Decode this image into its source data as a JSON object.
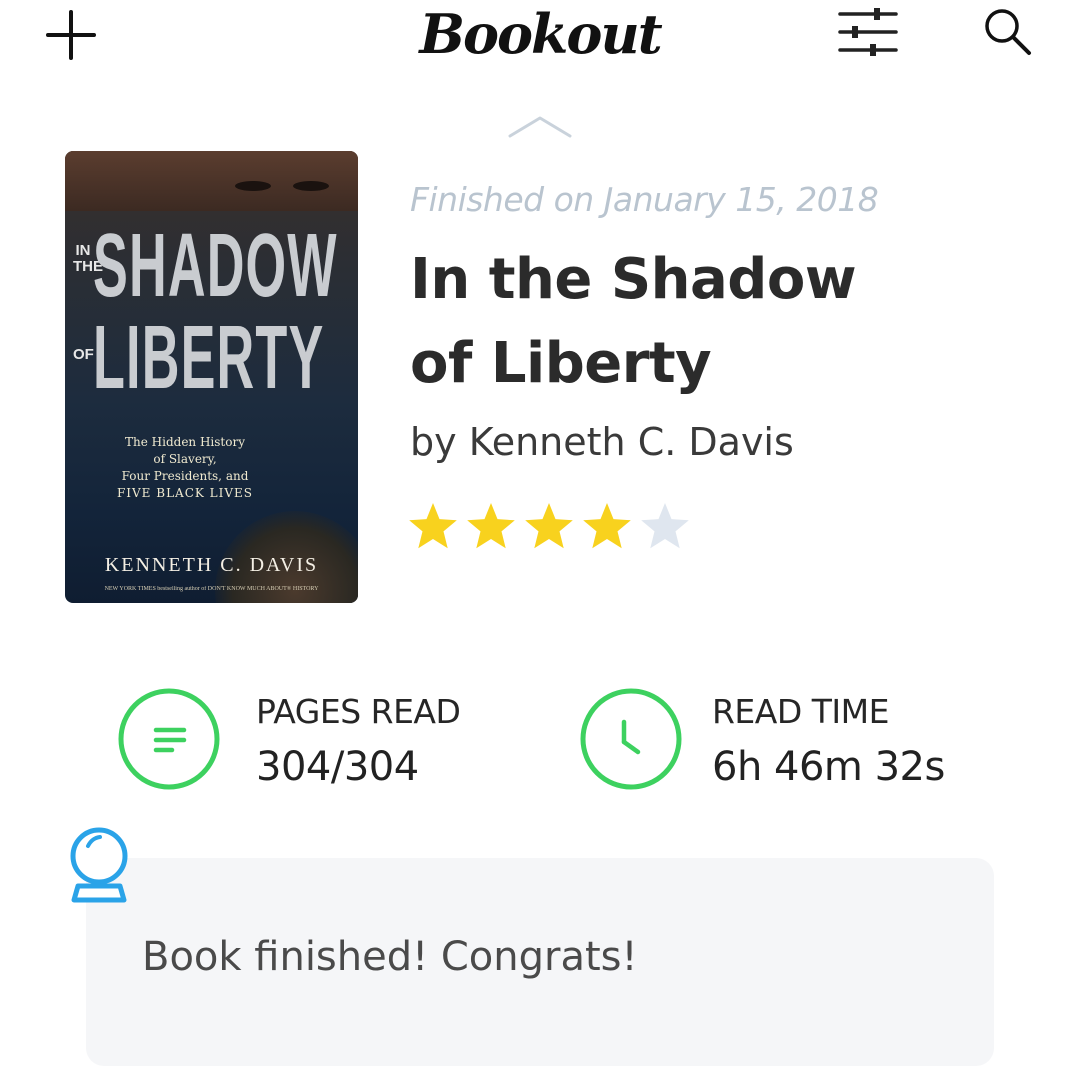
{
  "app": {
    "title": "Bookout"
  },
  "toolbar": {
    "add_icon": "plus-icon",
    "filter_icon": "sliders-icon",
    "search_icon": "search-icon",
    "collapse_icon": "chevron-up-icon"
  },
  "book": {
    "finished_text": "Finished on January 15, 2018",
    "title_line1": "In the Shadow",
    "title_line2": "of Liberty",
    "author_text": "by Kenneth C. Davis",
    "rating": 4,
    "rating_max": 5,
    "cover": {
      "side_top": "IN THE",
      "side_mid": "OF",
      "line1": "SHADOW",
      "line2": "LIBERTY",
      "subtitle_1": "The Hidden History",
      "subtitle_2": "of Slavery,",
      "subtitle_3": "Four Presidents, and",
      "subtitle_4": "FIVE BLACK LIVES",
      "author": "KENNETH C. DAVIS",
      "tagline": "NEW YORK TIMES bestselling author of DON'T KNOW MUCH ABOUT® HISTORY"
    }
  },
  "stats": {
    "pages_label": "PAGES READ",
    "pages_value": "304/304",
    "pages_icon": "document-lines-icon",
    "time_label": "READ TIME",
    "time_value": "6h 46m 32s",
    "time_icon": "clock-icon"
  },
  "message": {
    "icon": "crystal-ball-icon",
    "text": "Book finished! Congrats!"
  },
  "colors": {
    "accent_green": "#3dd15f",
    "star_filled": "#f8d21e",
    "star_empty": "#dfe6ef",
    "muted_text": "#b9c4cf",
    "message_bg": "#f5f6f8",
    "orb_blue": "#2aa3e8"
  }
}
